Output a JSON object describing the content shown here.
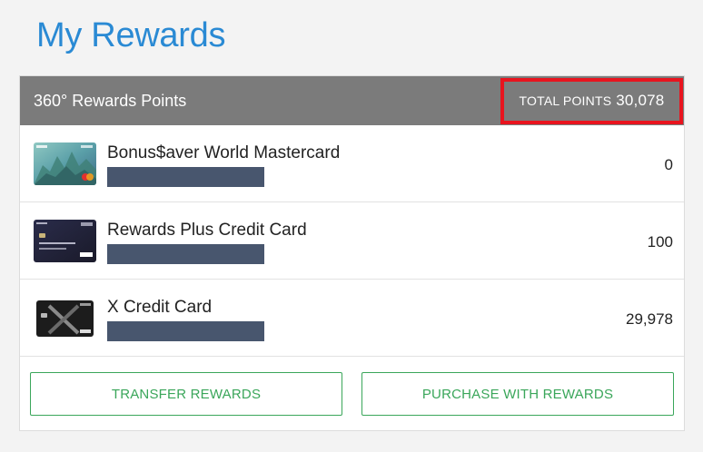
{
  "page": {
    "title": "My Rewards"
  },
  "panel": {
    "title": "360° Rewards Points",
    "total_label": "TOTAL POINTS",
    "total_value": "30,078"
  },
  "cards": [
    {
      "name": "Bonus$aver World Mastercard",
      "points": "0",
      "icon": "bonussaver-card-image"
    },
    {
      "name": "Rewards Plus Credit Card",
      "points": "100",
      "icon": "rewards-plus-card-image"
    },
    {
      "name": "X Credit Card",
      "points": "29,978",
      "icon": "x-card-image"
    }
  ],
  "actions": {
    "transfer_label": "TRANSFER REWARDS",
    "purchase_label": "PURCHASE WITH REWARDS"
  },
  "colors": {
    "title": "#2a8ad4",
    "header_bg": "#7b7b7b",
    "highlight": "#e8141e",
    "button_accent": "#3aa65a",
    "mask": "#48566e"
  }
}
